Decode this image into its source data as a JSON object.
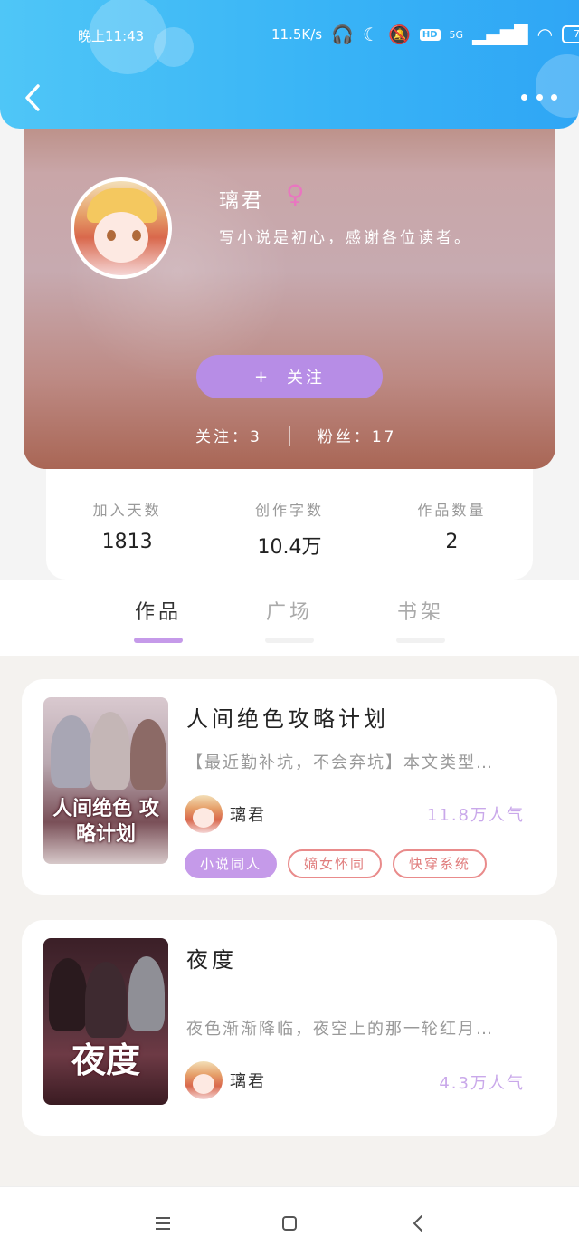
{
  "status_bar": {
    "time": "晚上11:43",
    "speed": "11.5K/s",
    "network": "5G",
    "battery": "70"
  },
  "profile": {
    "name": "璃君",
    "gender_symbol": "♀",
    "bio": "写小说是初心，感谢各位读者。",
    "follow_label": "关注",
    "follow_plus": "+",
    "following_label": "关注：3",
    "fans_label": "粉丝：17"
  },
  "stats": [
    {
      "label": "加入天数",
      "value": "1813"
    },
    {
      "label": "创作字数",
      "value": "10.4万"
    },
    {
      "label": "作品数量",
      "value": "2"
    }
  ],
  "tabs": [
    {
      "label": "作品",
      "active": true
    },
    {
      "label": "广场",
      "active": false
    },
    {
      "label": "书架",
      "active": false
    }
  ],
  "books": [
    {
      "title": "人间绝色攻略计划",
      "cover_title": "人间绝色 攻略计划",
      "description": "【最近勤补坑，不会弃坑】本文类型…",
      "author": "璃君",
      "popularity": "11.8万人气",
      "tags": [
        "小说同人",
        "嫡女怀同",
        "快穿系统"
      ]
    },
    {
      "title": "夜度",
      "cover_title": "夜度",
      "description": "夜色渐渐降临，夜空上的那一轮红月…",
      "author": "璃君",
      "popularity": "4.3万人气",
      "tags": []
    }
  ],
  "colors": {
    "header": "#39b4f6",
    "accent": "#c59ae9",
    "tag_outline": "#e98b8b"
  }
}
